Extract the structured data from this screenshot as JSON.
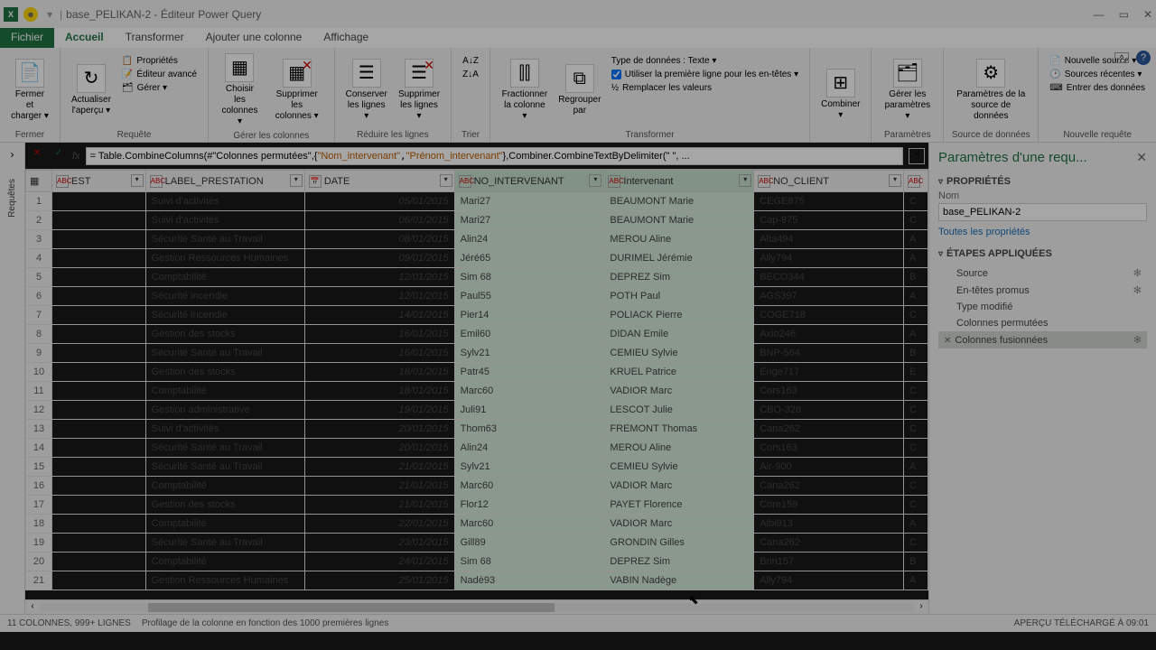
{
  "titlebar": {
    "filename": "base_PELIKAN-2",
    "app": "Éditeur Power Query"
  },
  "tabs": {
    "file": "Fichier",
    "home": "Accueil",
    "transform": "Transformer",
    "addcol": "Ajouter une colonne",
    "view": "Affichage"
  },
  "ribbon": {
    "close": {
      "label": "Fermer et\ncharger ▾",
      "group": "Fermer"
    },
    "refresh": {
      "label": "Actualiser\nl'aperçu ▾"
    },
    "props": {
      "p": "Propriétés",
      "e": "Éditeur avancé",
      "g": "Gérer ▾",
      "group": "Requête"
    },
    "choose": "Choisir les\ncolonnes ▾",
    "removecol": "Supprimer les\ncolonnes ▾",
    "gcols": "Gérer les colonnes",
    "keep": "Conserver\nles lignes ▾",
    "removerow": "Supprimer\nles lignes ▾",
    "grows": "Réduire les lignes",
    "sort": "Trier",
    "split": "Fractionner\nla colonne ▾",
    "group": "Regrouper\npar",
    "dtype": "Type de données : Texte ▾",
    "firstrow": "Utiliser la première ligne pour les en-têtes ▾",
    "replace": "Remplacer les valeurs",
    "gtrans": "Transformer",
    "combine": "Combiner\n▾",
    "params": "Gérer les\nparamètres ▾",
    "gparams": "Paramètres",
    "dssettings": "Paramètres de la\nsource de données",
    "gds": "Source de données",
    "newsrc": "Nouvelle source ▾",
    "recent": "Sources récentes ▾",
    "enter": "Entrer des données",
    "gnew": "Nouvelle requête"
  },
  "leftRail": "Requêtes",
  "formula": {
    "prefix": "= Table.CombineColumns(#\"Colonnes permutées\",{",
    "s1": "\"Nom_intervenant\"",
    "s2": "\"Prénom_intervenant\"",
    "mid": "},Combiner.CombineTextByDelimiter(\" \", ..."
  },
  "columns": [
    "",
    "EST",
    "LABEL_PRESTATION",
    "DATE",
    "NO_INTERVENANT",
    "Intervenant",
    "NO_CLIENT",
    ""
  ],
  "rows": [
    [
      "1",
      "",
      "Suivi d'activités",
      "05/01/2015",
      "Mari27",
      "BEAUMONT Marie",
      "CEGE875",
      "C"
    ],
    [
      "2",
      "",
      "Suivi d'activités",
      "06/01/2015",
      "Mari27",
      "BEAUMONT Marie",
      "Cap-975",
      "C"
    ],
    [
      "3",
      "",
      "Sécurité Santé au Travail",
      "08/01/2015",
      "Alin24",
      "MEROU Aline",
      "Alta494",
      "A"
    ],
    [
      "4",
      "",
      "Gestion Ressources Humaines",
      "09/01/2015",
      "Jéré65",
      "DURIMEL Jérémie",
      "Ally794",
      "A"
    ],
    [
      "5",
      "",
      "Comptabilité",
      "12/01/2015",
      "Sim 68",
      "DEPREZ Sim",
      "BECO344",
      "B"
    ],
    [
      "6",
      "",
      "Sécurité incendie",
      "12/01/2015",
      "Paul55",
      "POTH Paul",
      "AGS397",
      "A"
    ],
    [
      "7",
      "",
      "Sécurité incendie",
      "14/01/2015",
      "Pier14",
      "POLIACK Pierre",
      "COGE718",
      "C"
    ],
    [
      "8",
      "",
      "Gestion des stocks",
      "16/01/2015",
      "Emil60",
      "DIDAN Emile",
      "Axio246",
      "A"
    ],
    [
      "9",
      "",
      "Sécurité Santé au Travail",
      "16/01/2015",
      "Sylv21",
      "CEMIEU Sylvie",
      "BNP-564",
      "B"
    ],
    [
      "10",
      "",
      "Gestion des stocks",
      "18/01/2015",
      "Patr45",
      "KRUEL Patrice",
      "Enge717",
      "E"
    ],
    [
      "11",
      "",
      "Comptabilité",
      "18/01/2015",
      "Marc60",
      "VADIOR Marc",
      "Cors163",
      "C"
    ],
    [
      "12",
      "",
      "Gestion administrative",
      "19/01/2015",
      "Juli91",
      "LESCOT Julie",
      "CBO-328",
      "C"
    ],
    [
      "13",
      "",
      "Suivi d'activités",
      "20/01/2015",
      "Thom63",
      "FREMONT Thomas",
      "Cana262",
      "C"
    ],
    [
      "14",
      "",
      "Sécurité Santé au Travail",
      "20/01/2015",
      "Alin24",
      "MEROU Aline",
      "Cors163",
      "C"
    ],
    [
      "15",
      "",
      "Sécurité Santé au Travail",
      "21/01/2015",
      "Sylv21",
      "CEMIEU Sylvie",
      "Air-900",
      "A"
    ],
    [
      "16",
      "",
      "Comptabilité",
      "21/01/2015",
      "Marc60",
      "VADIOR Marc",
      "Cana262",
      "C"
    ],
    [
      "17",
      "",
      "Gestion des stocks",
      "21/01/2015",
      "Flor12",
      "PAYET Florence",
      "Core159",
      "C"
    ],
    [
      "18",
      "",
      "Comptabilité",
      "22/01/2015",
      "Marc60",
      "VADIOR Marc",
      "Albi913",
      "A"
    ],
    [
      "19",
      "",
      "Sécurité Santé au Travail",
      "23/01/2015",
      "Gill89",
      "GRONDIN Gilles",
      "Cana262",
      "C"
    ],
    [
      "20",
      "",
      "Comptabilité",
      "24/01/2015",
      "Sim 68",
      "DEPREZ Sim",
      "Brin157",
      "B"
    ],
    [
      "21",
      "",
      "Gestion Ressources Humaines",
      "25/01/2015",
      "Nadè93",
      "VABIN Nadège",
      "Ally794",
      "A"
    ]
  ],
  "panel": {
    "title": "Paramètres d'une requ...",
    "props": "PROPRIÉTÉS",
    "name": "Nom",
    "nameval": "base_PELIKAN-2",
    "allprops": "Toutes les propriétés",
    "steps_hdr": "ÉTAPES APPLIQUÉES",
    "steps": [
      "Source",
      "En-têtes promus",
      "Type modifié",
      "Colonnes permutées",
      "Colonnes fusionnées"
    ]
  },
  "status": {
    "left": "11 COLONNES, 999+ LIGNES",
    "mid": "Profilage de la colonne en fonction des 1000 premières lignes",
    "right": "APERÇU TÉLÉCHARGÉ À 09:01"
  }
}
